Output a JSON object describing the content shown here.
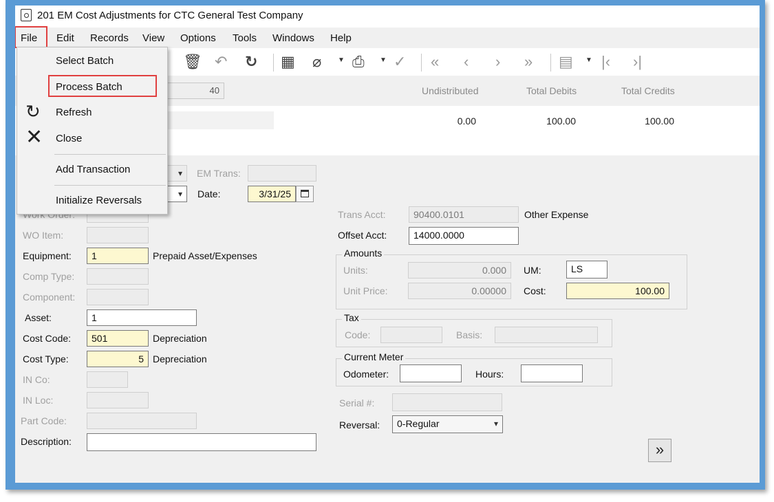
{
  "window": {
    "title": "201 EM Cost Adjustments for CTC General Test Company"
  },
  "menubar": {
    "items": [
      "File",
      "Edit",
      "Records",
      "View",
      "Options",
      "Tools",
      "Windows",
      "Help"
    ]
  },
  "file_menu": {
    "items": [
      "Select Batch",
      "Process Batch",
      "Refresh",
      "Close",
      "Add Transaction",
      "Initialize Reversals"
    ],
    "highlighted": "Process Batch"
  },
  "toolbar": {
    "icons": [
      "delete-icon",
      "undo-icon",
      "refresh-icon",
      "calculator-icon",
      "attach-icon",
      "print-icon",
      "spellcheck-icon",
      "first-record-icon",
      "previous-record-icon",
      "next-record-icon",
      "last-record-icon",
      "grid-settings-icon",
      "first-line-icon",
      "last-line-icon"
    ]
  },
  "summary": {
    "batch_count": "40",
    "headers": [
      "Undistributed",
      "Total Debits",
      "Total Credits"
    ],
    "values": [
      "0.00",
      "100.00",
      "100.00"
    ]
  },
  "form": {
    "em_trans_label": "EM Trans:",
    "em_trans_value": "",
    "date_label": "Date:",
    "date_value": "3/31/25",
    "work_order_label": "Work Order:",
    "wo_item_label": "WO Item:",
    "equipment_label": "Equipment:",
    "equipment_value": "1",
    "equipment_desc": "Prepaid Asset/Expenses",
    "comp_type_label": "Comp Type:",
    "component_label": "Component:",
    "asset_label": "Asset:",
    "asset_value": "1",
    "cost_code_label": "Cost Code:",
    "cost_code_value": "501",
    "cost_code_desc": "Depreciation",
    "cost_type_label": "Cost Type:",
    "cost_type_value": "5",
    "cost_type_desc": "Depreciation",
    "in_co_label": "IN Co:",
    "in_loc_label": "IN Loc:",
    "part_code_label": "Part Code:",
    "description_label": "Description:",
    "description_value": "",
    "trans_acct_label": "Trans Acct:",
    "trans_acct_value": "90400.0101",
    "trans_acct_desc": "Other Expense",
    "offset_acct_label": "Offset Acct:",
    "offset_acct_value": "14000.0000",
    "amounts_title": "Amounts",
    "units_label": "Units:",
    "units_value": "0.000",
    "um_label": "UM:",
    "um_value": "LS",
    "unit_price_label": "Unit Price:",
    "unit_price_value": "0.00000",
    "cost_label": "Cost:",
    "cost_value": "100.00",
    "tax_title": "Tax",
    "tax_code_label": "Code:",
    "tax_basis_label": "Basis:",
    "meter_title": "Current Meter",
    "odometer_label": "Odometer:",
    "hours_label": "Hours:",
    "serial_label": "Serial #:",
    "reversal_label": "Reversal:",
    "reversal_value": "0-Regular",
    "more_button": "»"
  },
  "colors": {
    "frame_blue": "#5b9bd5",
    "highlight_red": "#e04040",
    "required_yellow": "#fdf8d0"
  }
}
